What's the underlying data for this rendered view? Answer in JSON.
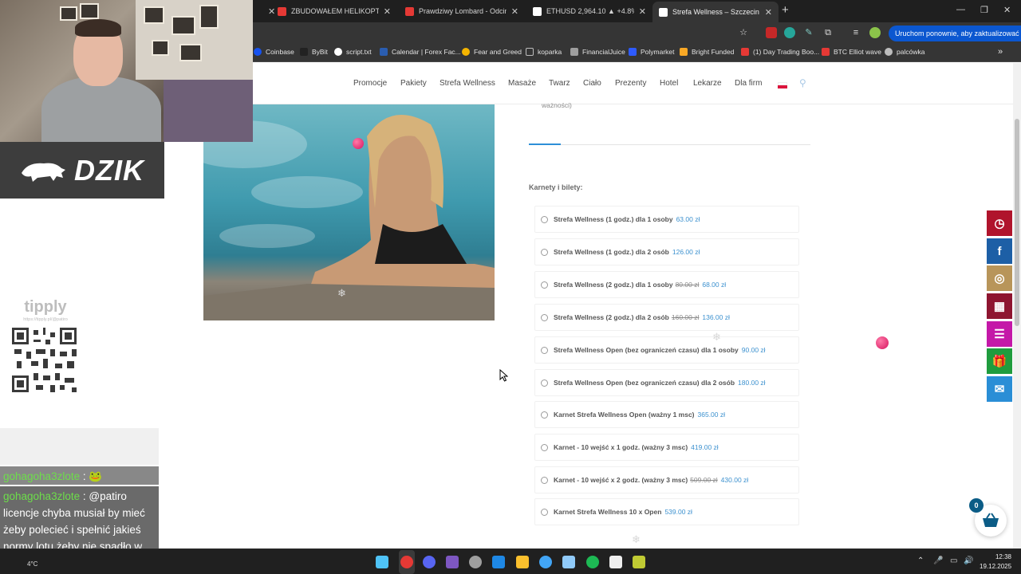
{
  "browser": {
    "tabs": [
      {
        "title": "ZBUDOWAŁEM HELIKOPTER KT",
        "favicon_color": "#e53935",
        "active": false
      },
      {
        "title": "Prawdziwy Lombard - Odcinek",
        "favicon_color": "#e53935",
        "active": false
      },
      {
        "title": "ETHUSD 2,964.10 ▲ +4.8% Bez",
        "favicon_color": "#ffffff",
        "active": false
      },
      {
        "title": "Strefa Wellness – Szczecin | Bal",
        "favicon_color": "#ffffff",
        "active": true
      }
    ],
    "new_tab_icon": "plus-icon",
    "update_button_label": "Uruchom ponownie, aby zaktualizować",
    "bookmarks": [
      {
        "label": "Coinbase",
        "color": "#1652f0"
      },
      {
        "label": "ByBit",
        "color": "#222222"
      },
      {
        "label": "script.txt",
        "color": "#ffffff"
      },
      {
        "label": "Calendar | Forex Fac...",
        "color": "#2a5db0"
      },
      {
        "label": "Fear and Greed",
        "color": "#f4b400"
      },
      {
        "label": "koparka",
        "color": "#bdbdbd"
      },
      {
        "label": "FinancialJuice",
        "color": "#9e9e9e"
      },
      {
        "label": "Polymarket",
        "color": "#2e5bff"
      },
      {
        "label": "Bright Funded",
        "color": "#f9a825"
      },
      {
        "label": "(1) Day Trading Boo...",
        "color": "#e53935"
      },
      {
        "label": "BTC Elliot wave",
        "color": "#e53935"
      },
      {
        "label": "palcówka",
        "color": "#bdbdbd"
      }
    ]
  },
  "site": {
    "nav": [
      "Promocje",
      "Pakiety",
      "Strefa Wellness",
      "Masaże",
      "Twarz",
      "Ciało",
      "Prezenty",
      "Hotel",
      "Lekarze",
      "Dla firm"
    ],
    "truncated_text": "ważności)",
    "section_label": "Karnety i bilety:",
    "options": [
      {
        "name": "Strefa Wellness (1 godz.) dla 1 osoby",
        "old_price": "",
        "price": "63.00 zł"
      },
      {
        "name": "Strefa Wellness (1 godz.) dla 2 osób",
        "old_price": "",
        "price": "126.00 zł"
      },
      {
        "name": "Strefa Wellness (2 godz.) dla 1 osoby",
        "old_price": "80.00 zł",
        "price": "68.00 zł"
      },
      {
        "name": "Strefa Wellness (2 godz.) dla 2 osób",
        "old_price": "160.00 zł",
        "price": "136.00 zł"
      },
      {
        "name": "Strefa Wellness Open (bez ograniczeń czasu) dla 1 osoby",
        "old_price": "",
        "price": "90.00 zł"
      },
      {
        "name": "Strefa Wellness Open (bez ograniczeń czasu) dla 2 osób",
        "old_price": "",
        "price": "180.00 zł"
      },
      {
        "name": "Karnet Strefa Wellness Open (ważny 1 msc)",
        "old_price": "",
        "price": "365.00 zł"
      },
      {
        "name": "Karnet - 10 wejść x 1 godz. (ważny 3 msc)",
        "old_price": "",
        "price": "419.00 zł"
      },
      {
        "name": "Karnet - 10 wejść x 2 godz. (ważny 3 msc)",
        "old_price": "509.00 zł",
        "price": "430.00 zł"
      },
      {
        "name": "Karnet Strefa Wellness 10 x Open",
        "old_price": "",
        "price": "539.00 zł"
      }
    ],
    "side_buttons": [
      {
        "icon": "clock-icon",
        "color": "#b0142c"
      },
      {
        "icon": "facebook-icon",
        "color": "#1d5fa6"
      },
      {
        "icon": "instagram-icon",
        "color": "#b8955a"
      },
      {
        "icon": "calendar-icon",
        "color": "#8e1530"
      },
      {
        "icon": "list-icon",
        "color": "#c418a8"
      },
      {
        "icon": "gift-icon",
        "color": "#1f9c3e"
      },
      {
        "icon": "message-icon",
        "color": "#2a8ed6"
      }
    ],
    "cart_count": "0"
  },
  "overlay": {
    "brand": "DZIK",
    "tipply_logo": "tipply",
    "tipply_url": "https://tipply.pl/@patiro",
    "chat": [
      {
        "user": "gohagoha3zlote",
        "sep": " : ",
        "message": "🐸"
      },
      {
        "user": "gohagoha3zlote",
        "sep": " : ",
        "message": "@patiro licencje chyba musiał by mieć żeby polecieć i spełnić jakieś normy lotu żeby nie spadło w trakcie lotu"
      }
    ]
  },
  "taskbar": {
    "time": "12:38",
    "date": "19.12.2025",
    "weather_temp": "4°C"
  }
}
